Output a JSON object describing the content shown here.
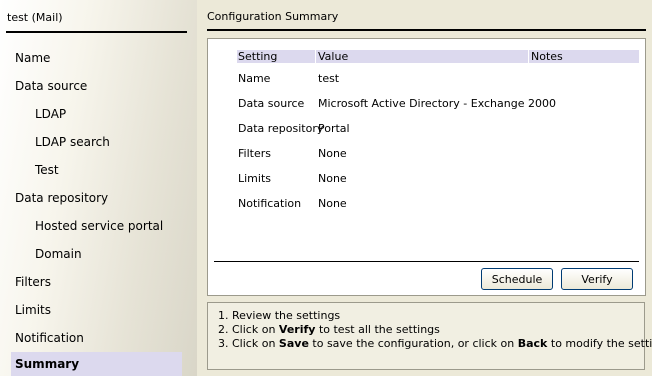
{
  "sidebar": {
    "title": "test (Mail)",
    "items": [
      {
        "label": "Name"
      },
      {
        "label": "Data source"
      },
      {
        "label": "LDAP"
      },
      {
        "label": "LDAP search"
      },
      {
        "label": "Test"
      },
      {
        "label": "Data repository"
      },
      {
        "label": "Hosted service portal"
      },
      {
        "label": "Domain"
      },
      {
        "label": "Filters"
      },
      {
        "label": "Limits"
      },
      {
        "label": "Notification"
      },
      {
        "label": "Summary"
      }
    ],
    "active_item": "Summary"
  },
  "main": {
    "title": "Configuration Summary",
    "table": {
      "headers": {
        "setting": "Setting",
        "value": "Value",
        "notes": "Notes"
      },
      "rows": [
        {
          "setting": "Name",
          "value": "test"
        },
        {
          "setting": "Data source",
          "value": "Microsoft Active Directory - Exchange 2000"
        },
        {
          "setting": "Data repository",
          "value": "Portal"
        },
        {
          "setting": "Filters",
          "value": "None"
        },
        {
          "setting": "Limits",
          "value": "None"
        },
        {
          "setting": "Notification",
          "value": "None"
        }
      ]
    },
    "buttons": {
      "schedule": "Schedule",
      "verify": "Verify"
    }
  },
  "instructions": {
    "line1": {
      "num": "1.",
      "text": "Review the settings"
    },
    "line2": {
      "num": "2.",
      "pre": "Click on",
      "bold": "Verify",
      "post": "to test all the settings"
    },
    "line3": {
      "num": "3.",
      "pre": "Click on",
      "bold": "Save",
      "mid": "to save the configuration, or click on",
      "bold2": "Back",
      "post": "to modify the settings"
    }
  },
  "colors": {
    "window_bg": "#ece9d8",
    "header_highlight": "#dcd9ee",
    "instructions_bg": "#f1efe2"
  }
}
